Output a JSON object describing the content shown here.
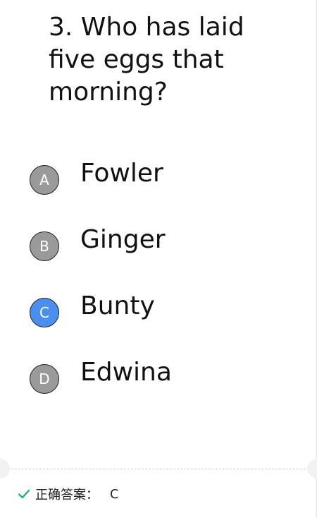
{
  "question": {
    "text": "3. Who has laid five eggs that morning?"
  },
  "options": [
    {
      "letter": "A",
      "label": "Fowler",
      "selected": false
    },
    {
      "letter": "B",
      "label": "Ginger",
      "selected": false
    },
    {
      "letter": "C",
      "label": "Bunty",
      "selected": true
    },
    {
      "letter": "D",
      "label": "Edwina",
      "selected": false
    }
  ],
  "answer": {
    "icon": "check-icon",
    "label": "正确答案：",
    "value": "C"
  },
  "colors": {
    "selected_badge": "#4a8ff0",
    "unselected_badge": "#9a9a9a",
    "check": "#21b36b"
  }
}
